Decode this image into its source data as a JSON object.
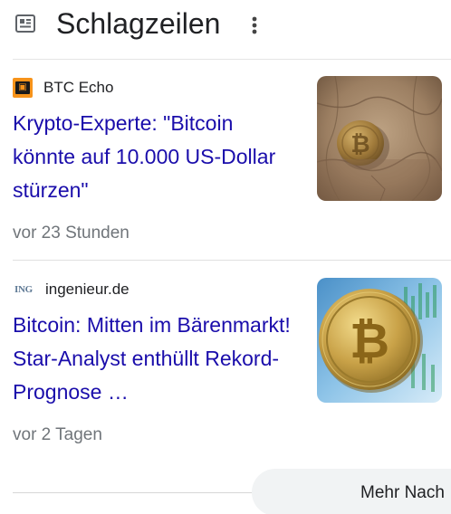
{
  "header": {
    "title": "Schlagzeilen",
    "icon": "newspaper-icon",
    "menu_icon": "more-vert-icon"
  },
  "articles": [
    {
      "source": "BTC Echo",
      "source_logo_icon": "btc-echo-logo",
      "headline": "Krypto-Experte: \"Bitcoin könnte auf 10.000 US-Dollar stürzen\"",
      "time": "vor 23 Stunden",
      "thumbnail": "bitcoin-coin-in-dry-earth"
    },
    {
      "source": "ingenieur.de",
      "source_logo_icon": "ingenieur-logo",
      "source_logo_text": "ING",
      "headline": "Bitcoin: Mitten im Bärenmarkt! Star-Analyst enthüllt Rekord-Prognose …",
      "time": "vor 2 Tagen",
      "thumbnail": "bitcoin-coin-on-chart"
    }
  ],
  "footer": {
    "more_label": "Mehr Nach"
  },
  "colors": {
    "headline_link": "#1a0dab",
    "meta_text": "#70757a",
    "title_text": "#202124",
    "button_bg": "#f1f3f4"
  }
}
